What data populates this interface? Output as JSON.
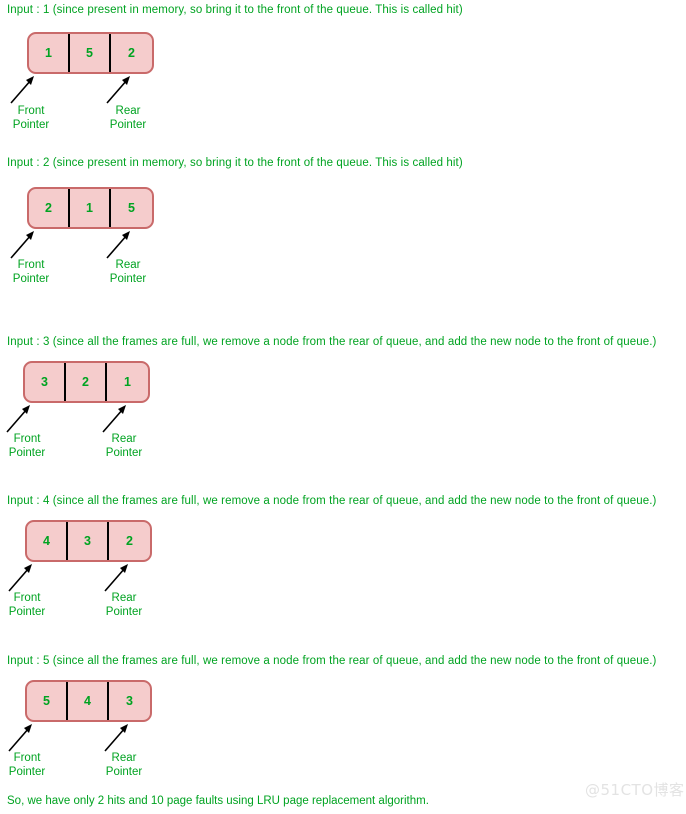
{
  "colors": {
    "text_green": "#00a321",
    "box_fill": "#f5cccc",
    "box_border": "#c96a6a",
    "divider": "#000000",
    "background": "#ffffff",
    "watermark": "#e3e3e3"
  },
  "pointer_labels": {
    "front_line1": "Front",
    "front_line2": "Pointer",
    "rear_line1": "Rear",
    "rear_line2": "Pointer"
  },
  "steps": [
    {
      "caption": "Input : 1 (since present in memory, so bring it to the front of the queue. This is called hit)",
      "cells": [
        "1",
        "5",
        "2"
      ],
      "input": "1",
      "event": "hit"
    },
    {
      "caption": "Input : 2 (since present in memory, so bring it to the front of the queue. This is called hit)",
      "cells": [
        "2",
        "1",
        "5"
      ],
      "input": "2",
      "event": "hit"
    },
    {
      "caption": "Input : 3 (since all the frames are full, we remove a node from the rear of queue, and add the new node to the front of queue.)",
      "cells": [
        "3",
        "2",
        "1"
      ],
      "input": "3",
      "event": "page fault"
    },
    {
      "caption": "Input : 4 (since all the frames are full, we remove a node from the rear of queue, and add the new node to the front of queue.)",
      "cells": [
        "4",
        "3",
        "2"
      ],
      "input": "4",
      "event": "page fault"
    },
    {
      "caption": "Input : 5 (since all the frames are full, we remove a node from the rear of queue, and add the new node to the front of queue.)",
      "cells": [
        "5",
        "4",
        "3"
      ],
      "input": "5",
      "event": "page fault"
    }
  ],
  "footer": {
    "summary": "So, we have only 2 hits and 10 page faults using LRU page replacement algorithm.",
    "hits": "2",
    "page_faults": "10",
    "algorithm": "LRU page replacement algorithm"
  },
  "watermark": {
    "text": "@51CTO博客"
  }
}
